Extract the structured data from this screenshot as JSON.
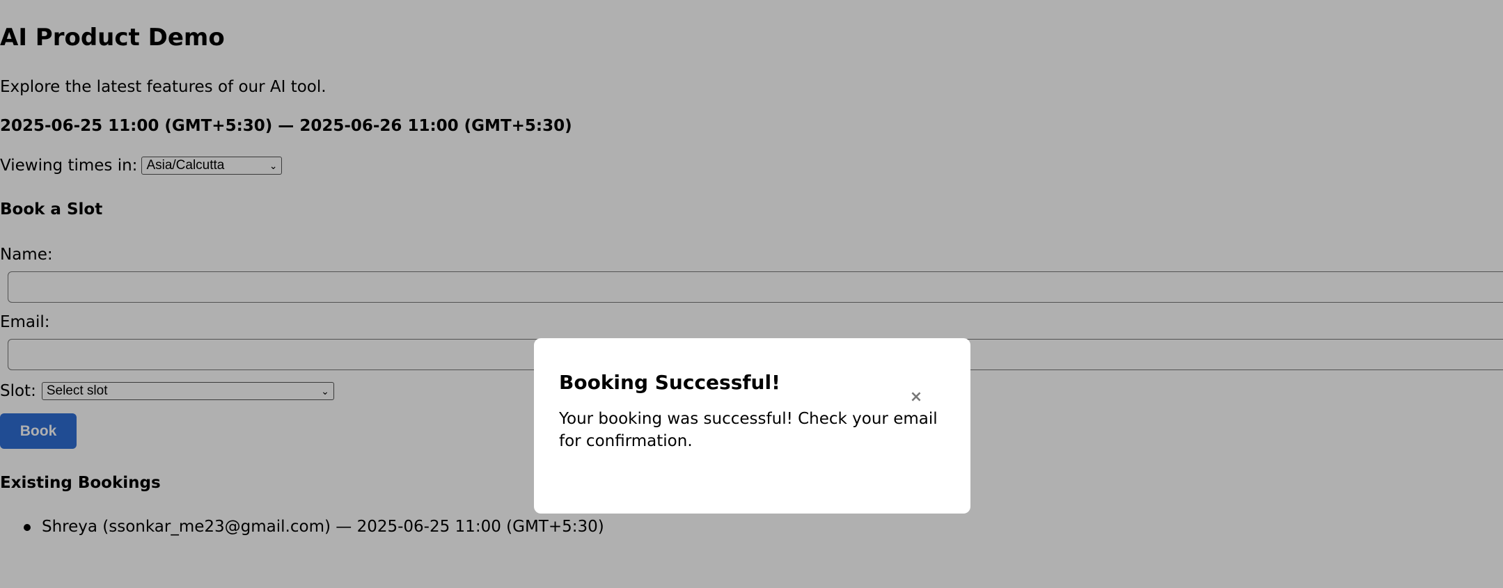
{
  "page": {
    "title": "AI Product Demo",
    "description": "Explore the latest features of our AI tool.",
    "date_range": "2025-06-25 11:00 (GMT+5:30) — 2025-06-26 11:00 (GMT+5:30)",
    "timezone": {
      "label": "Viewing times in:",
      "selected": "Asia/Calcutta"
    }
  },
  "booking_form": {
    "heading": "Book a Slot",
    "name_label": "Name:",
    "name_value": "",
    "email_label": "Email:",
    "email_value": "",
    "slot_label": "Slot:",
    "slot_selected": "Select slot",
    "book_label": "Book",
    "accent_color": "#2f6fd6"
  },
  "existing": {
    "heading": "Existing Bookings",
    "items": [
      "Shreya (ssonkar_me23@gmail.com) — 2025-06-25 11:00 (GMT+5:30)"
    ]
  },
  "modal": {
    "title": "Booking Successful!",
    "message": "Your booking was successful! Check your email for confirmation.",
    "close_icon": "×"
  }
}
